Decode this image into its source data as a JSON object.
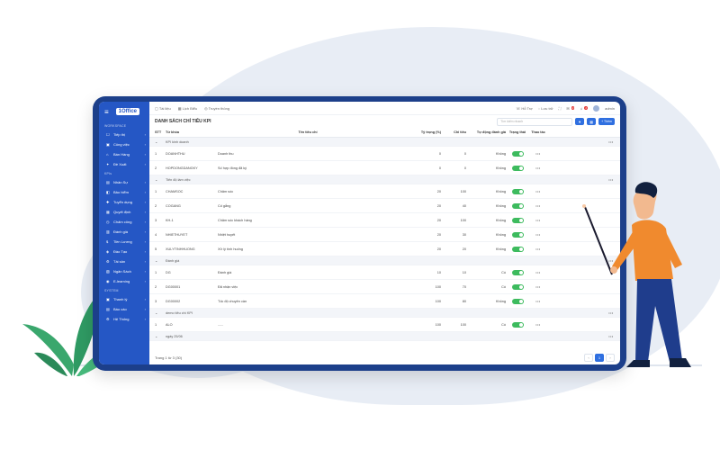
{
  "sidebar": {
    "sections": [
      "WORKSPACE",
      "KPIs",
      "SYSTEM"
    ],
    "workspace_items": [
      {
        "icon": "inbox-icon",
        "glyph": "☐",
        "label": "Tiếp thị"
      },
      {
        "icon": "briefcase-icon",
        "glyph": "▣",
        "label": "Công việc"
      },
      {
        "icon": "store-icon",
        "glyph": "⌂",
        "label": "Bán Hàng"
      },
      {
        "icon": "gift-icon",
        "glyph": "✦",
        "label": "Đề Xuất"
      }
    ],
    "kpi_items": [
      {
        "icon": "document-icon",
        "glyph": "▤",
        "label": "Nhân Sự"
      },
      {
        "icon": "wallet-icon",
        "glyph": "◧",
        "label": "Bảo hiểm"
      },
      {
        "icon": "user-plus-icon",
        "glyph": "✚",
        "label": "Tuyển dụng"
      },
      {
        "icon": "calendar-icon",
        "glyph": "▦",
        "label": "Quyết định"
      },
      {
        "icon": "clock-icon",
        "glyph": "◷",
        "label": "Chấm công"
      },
      {
        "icon": "chart-icon",
        "glyph": "▥",
        "label": "Đánh giá"
      },
      {
        "icon": "salary-icon",
        "glyph": "$",
        "label": "Tiền Lương"
      },
      {
        "icon": "book-icon",
        "glyph": "◈",
        "label": "Đào Tạo"
      },
      {
        "icon": "network-icon",
        "glyph": "⚙",
        "label": "Tài sản"
      },
      {
        "icon": "folder-icon",
        "glyph": "▧",
        "label": "Ngân Sách"
      },
      {
        "icon": "elearning-icon",
        "glyph": "◉",
        "label": "E-learning"
      }
    ],
    "system_items": [
      {
        "icon": "task-icon",
        "glyph": "▣",
        "label": "Thanh lý"
      },
      {
        "icon": "report-icon",
        "glyph": "▤",
        "label": "Báo cáo"
      },
      {
        "icon": "settings-icon",
        "glyph": "⚙",
        "label": "Hệ Thống"
      }
    ]
  },
  "topbar": {
    "left": [
      "Tài liệu",
      "Lịch Biểu",
      "Truyền thông"
    ],
    "right": [
      "Hỗ Trợ",
      "Lưu trữ"
    ],
    "badges": [
      "2",
      "2"
    ],
    "user": "admin"
  },
  "page": {
    "title": "DANH SÁCH CHỈ TIÊU KPI",
    "search_placeholder": "Tìm kiếm nhanh",
    "add_label": "+ Thêm"
  },
  "table": {
    "headers": [
      "STT",
      "Từ khóa",
      "Tên tiêu chí",
      "Tỷ trọng (%)",
      "Chỉ tiêu",
      "Tự động đánh giá",
      "Trạng thái",
      "Thao tác"
    ],
    "groups": [
      {
        "name": "KPI kinh doanh",
        "rows": [
          [
            "1",
            "DOANHTHU",
            "Doanh thu",
            "0",
            "0",
            "Không"
          ],
          [
            "2",
            "HOPDONGDANGKY",
            "Số hợp đồng đã ký",
            "0",
            "0",
            "Không"
          ]
        ]
      },
      {
        "name": "Tiến độ làm việc",
        "rows": [
          [
            "1",
            "CHAMSOC",
            "Chăm sóc",
            "20",
            "100",
            "Không"
          ],
          [
            "2",
            "COGANG",
            "Cố gắng",
            "20",
            "40",
            "Không"
          ],
          [
            "3",
            "KH-1",
            "Chăm sóc khách hàng",
            "20",
            "100",
            "Không"
          ],
          [
            "4",
            "NHIETHUYET",
            "Nhiệt huyết",
            "20",
            "30",
            "Không"
          ],
          [
            "5",
            "XULYTINHHUONG",
            "Xử lý tình huống",
            "20",
            "20",
            "Không"
          ]
        ]
      },
      {
        "name": "Đánh giá",
        "rows": [
          [
            "1",
            "DG",
            "Đánh giá",
            "10",
            "10",
            "Có"
          ],
          [
            "2",
            "DG00001",
            "Đã nhận việc",
            "100",
            "70",
            "Có"
          ],
          [
            "3",
            "DG00002",
            "Tốc độ chuyên cần",
            "100",
            "80",
            "Không"
          ]
        ]
      },
      {
        "name": "demo tiêu chí KPI",
        "rows": [
          [
            "1",
            "ALO",
            "......",
            "100",
            "100",
            "Có"
          ]
        ]
      },
      {
        "name": "ngày 25/06",
        "rows": []
      }
    ],
    "action_glyph": "•••"
  },
  "footer": {
    "info": "Trang 1 từ 3 (30)",
    "pages": [
      "‹",
      "1",
      "›"
    ],
    "current": "1"
  },
  "colors": {
    "sidebar": "#2557c5",
    "accent": "#2f6fe0",
    "toggle_on": "#3dbb5e",
    "frame": "#1c3f8a"
  }
}
